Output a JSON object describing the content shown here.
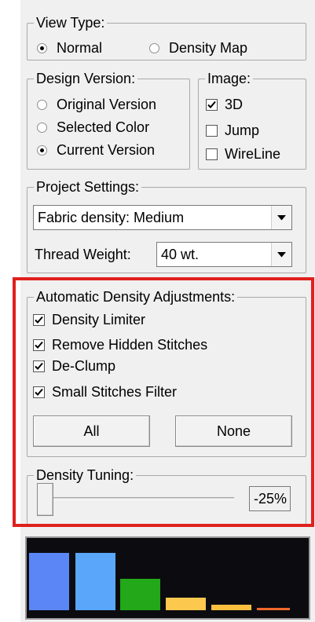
{
  "view_type": {
    "legend": "View Type:",
    "options": [
      {
        "label": "Normal",
        "selected": true
      },
      {
        "label": "Density Map",
        "selected": false
      }
    ]
  },
  "design_version": {
    "legend": "Design Version:",
    "options": [
      {
        "label": "Original Version",
        "selected": false
      },
      {
        "label": "Selected Color",
        "selected": false
      },
      {
        "label": "Current Version",
        "selected": true
      }
    ]
  },
  "image": {
    "legend": "Image:",
    "options": [
      {
        "label": "3D",
        "checked": true
      },
      {
        "label": "Jump",
        "checked": false
      },
      {
        "label": "WireLine",
        "checked": false
      }
    ]
  },
  "project_settings": {
    "legend": "Project Settings:",
    "fabric_density": "Fabric density: Medium",
    "thread_weight_label": "Thread Weight:",
    "thread_weight": "40 wt."
  },
  "auto_density": {
    "legend": "Automatic Density Adjustments:",
    "options": [
      {
        "label": "Density Limiter",
        "checked": true
      },
      {
        "label": "Remove Hidden Stitches",
        "checked": true
      },
      {
        "label": "De-Clump",
        "checked": true
      },
      {
        "label": "Small Stitches Filter",
        "checked": true
      }
    ],
    "all_button": "All",
    "none_button": "None"
  },
  "density_tuning": {
    "legend": "Density Tuning:",
    "value": "-25%"
  },
  "histogram": {
    "bar_colors": [
      "#5b86f6",
      "#5aa6fb",
      "#22a818",
      "#fcc94e",
      "#fcbf3e",
      "#f0682a"
    ],
    "levels": [
      0.89,
      0.89,
      0.49,
      0.2,
      0.09,
      0.04
    ]
  },
  "highlight_color": "#e0201e"
}
